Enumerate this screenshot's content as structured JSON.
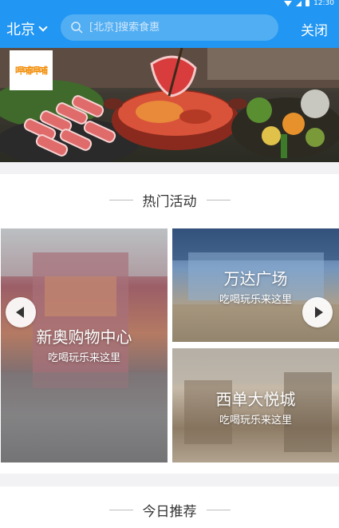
{
  "status_bar": {
    "time": "12:30",
    "icons": [
      "wifi-icon",
      "signal-icon",
      "battery-icon"
    ]
  },
  "header": {
    "city": "北京",
    "search_placeholder": "[北京]搜索食惠",
    "close_label": "关闭",
    "accent_color": "#2196f3"
  },
  "banner": {
    "logo_text": "呷哺呷哺",
    "logo_color": "#f28a00"
  },
  "hot_activities": {
    "title": "热门活动",
    "cards": [
      {
        "title": "新奥购物中心",
        "subtitle": "吃喝玩乐来这里"
      },
      {
        "title": "万达广场",
        "subtitle": "吃喝玩乐来这里"
      },
      {
        "title": "西单大悦城",
        "subtitle": "吃喝玩乐来这里"
      }
    ]
  },
  "today_recommend": {
    "title": "今日推荐"
  }
}
